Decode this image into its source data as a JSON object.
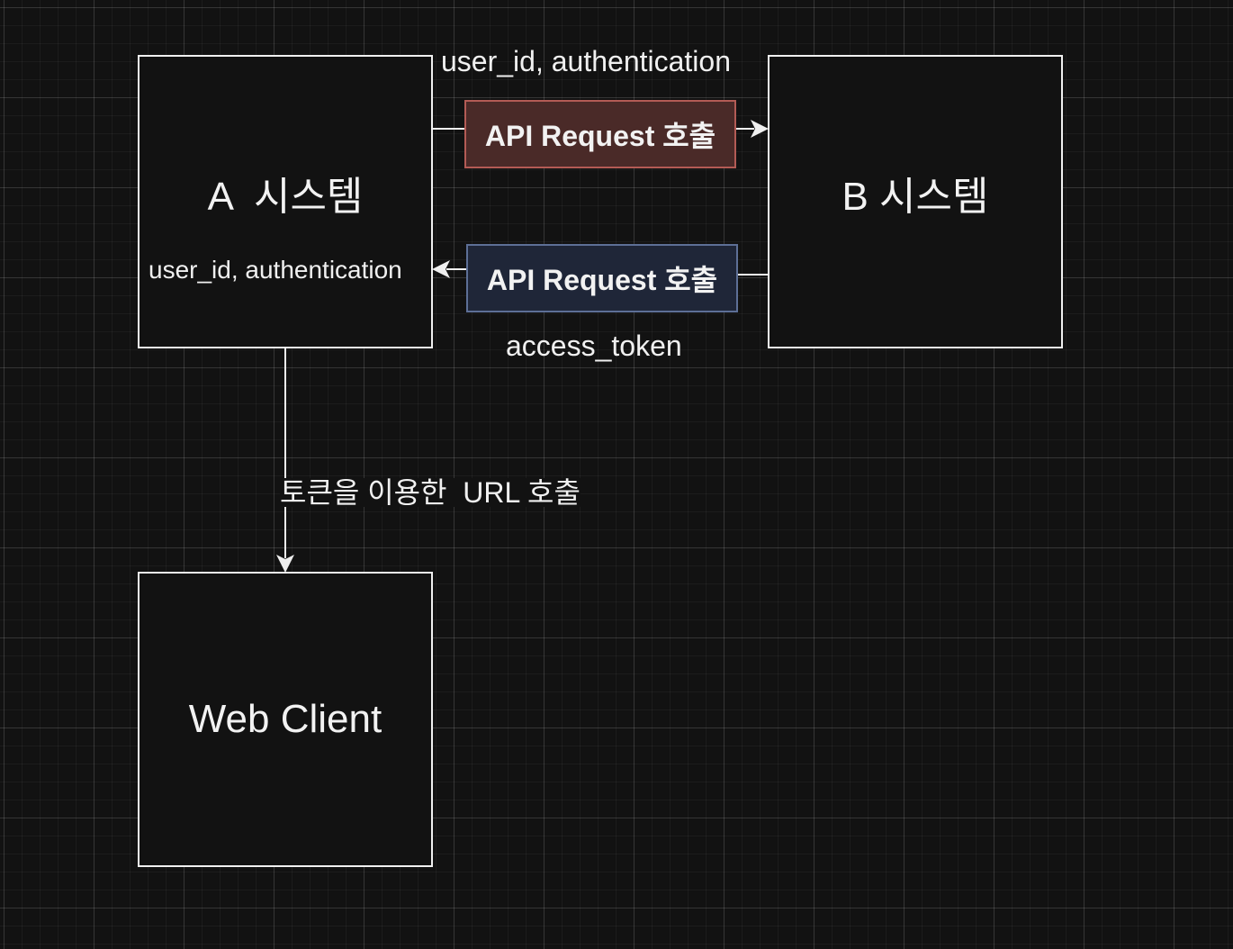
{
  "nodes": {
    "system_a": "A  시스템",
    "system_b": "B 시스템",
    "web_client": "Web Client"
  },
  "edges": {
    "request": {
      "box_label": "API Request 호출",
      "payload_label": "user_id, authentication"
    },
    "response": {
      "box_label": "API Request 호출",
      "payload_label": "access_token"
    },
    "a_inner_label": "user_id, authentication",
    "to_client_label": "토큰을 이용한  URL 호출"
  },
  "colors": {
    "background": "#121212",
    "line": "#f0f0f0",
    "request_fill": "#4a2a28",
    "request_border": "#b35b55",
    "response_fill": "#1f2638",
    "response_border": "#5d6f96"
  }
}
